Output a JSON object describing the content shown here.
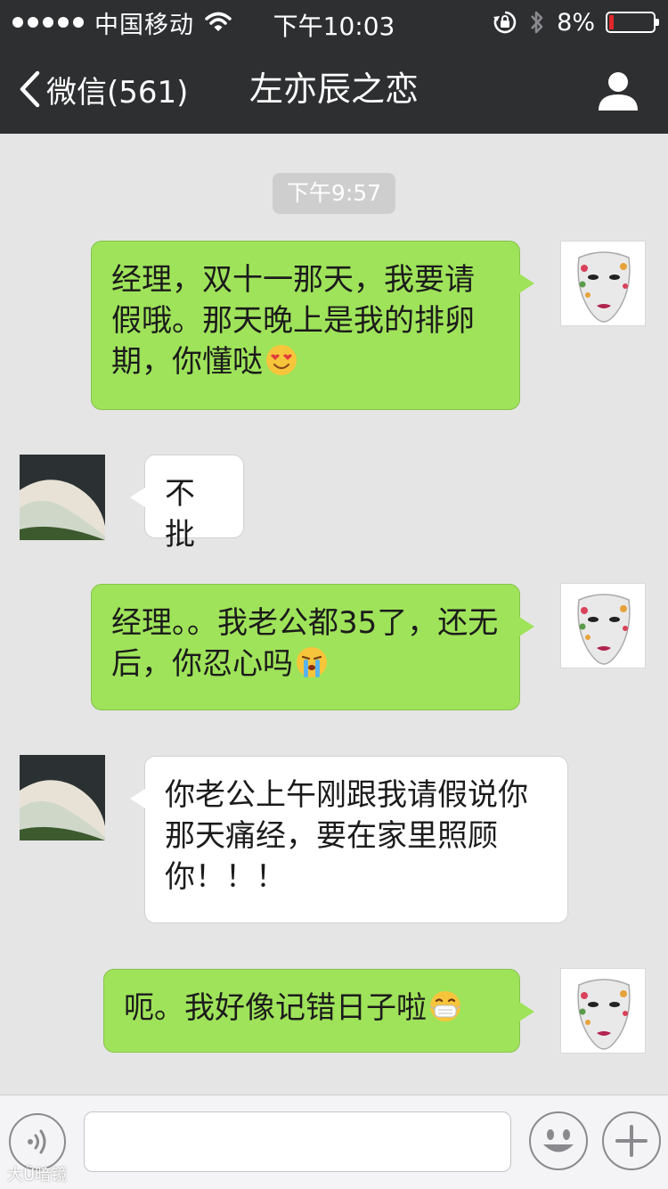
{
  "status_bar": {
    "carrier": "中国移动",
    "time": "下午10:03",
    "battery": "8%",
    "battery_level": 0.08
  },
  "nav": {
    "back_label": "微信(561)",
    "title": "左亦辰之恋"
  },
  "chat": {
    "timestamp": "下午9:57",
    "messages": [
      {
        "sender": "me",
        "text": "经理，双十一那天，我要请假哦。那天晚上是我的排卵期，你懂哒",
        "emoji": "heart-eyes-emoji"
      },
      {
        "sender": "other",
        "text": "不批"
      },
      {
        "sender": "me",
        "text": "经理。。我老公都35了，还无后，你忍心吗",
        "emoji": "crying-emoji"
      },
      {
        "sender": "other",
        "text": "你老公上午刚跟我请假说你那天痛经，要在家里照顾你！！！"
      },
      {
        "sender": "me",
        "text": "呃。我好像记错日子啦",
        "emoji": "mask-emoji"
      }
    ]
  },
  "input_bar": {
    "value": "",
    "placeholder": ""
  },
  "watermark": "大Ü暗镜",
  "colors": {
    "header_bg": "#2e2f31",
    "chat_bg": "#e5e5e5",
    "my_bubble": "#9fe35a",
    "other_bubble": "#ffffff",
    "battery_low": "#e2262a"
  }
}
